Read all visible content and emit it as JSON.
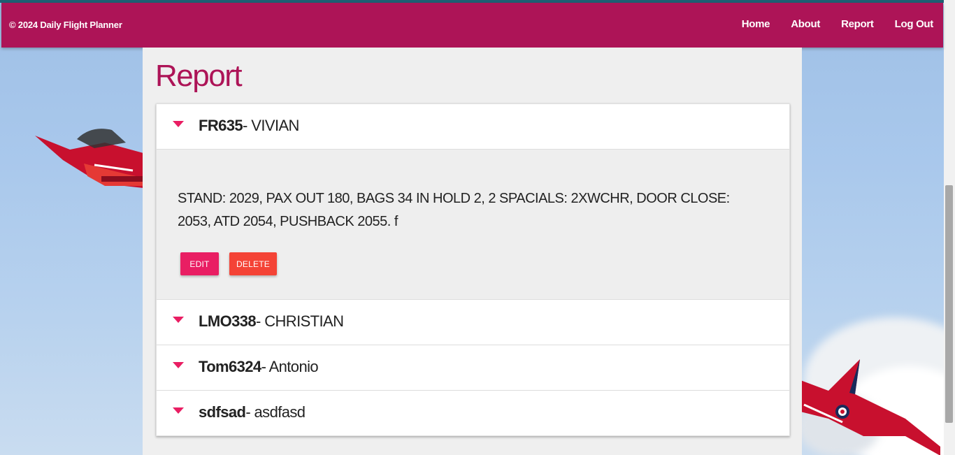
{
  "navbar": {
    "brand": "© 2024 Daily Flight Planner",
    "links": [
      {
        "label": "Home"
      },
      {
        "label": "About"
      },
      {
        "label": "Report"
      },
      {
        "label": "Log Out"
      }
    ]
  },
  "page": {
    "title": "Report"
  },
  "reports": [
    {
      "code": "FR635",
      "name": "- VIVIAN",
      "expanded": true,
      "details": "STAND: 2029, PAX OUT 180, BAGS 34 IN HOLD 2, 2 SPACIALS: 2XWCHR, DOOR CLOSE: 2053, ATD 2054, PUSHBACK 2055. f",
      "edit_label": "EDIT",
      "delete_label": "DELETE"
    },
    {
      "code": "LMO338",
      "name": "- CHRISTIAN",
      "expanded": false
    },
    {
      "code": "Tom6324",
      "name": "- Antonio",
      "expanded": false
    },
    {
      "code": "sdfsad",
      "name": "- asdfasd",
      "expanded": false
    }
  ],
  "colors": {
    "navbar": "#ad1457",
    "accent": "#e91e63",
    "delete": "#f44336",
    "title": "#ad1457"
  },
  "icons": {
    "expand": "caret-down-icon"
  }
}
